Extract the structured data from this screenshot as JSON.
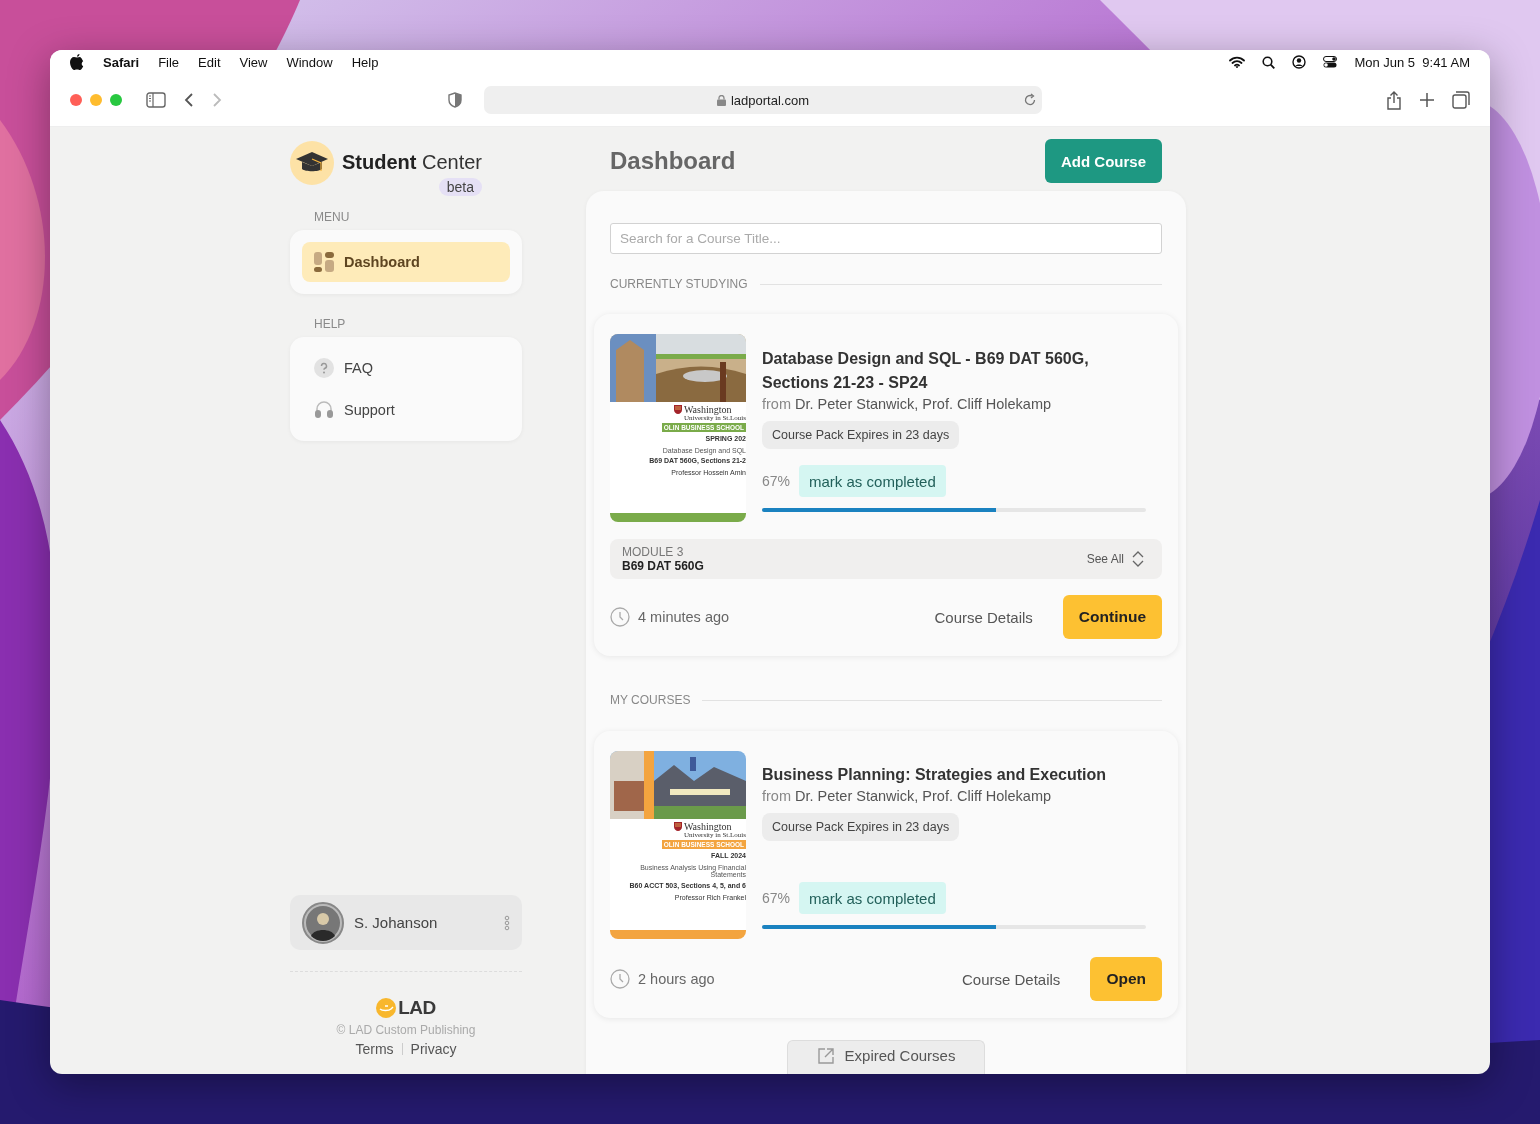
{
  "menubar": {
    "app": "Safari",
    "menus": [
      "File",
      "Edit",
      "View",
      "Window",
      "Help"
    ],
    "clock": "Mon Jun 5  9:41 AM"
  },
  "browser": {
    "url": "ladportal.com"
  },
  "brand": {
    "title_bold": "Student",
    "title_light": "Center",
    "badge": "beta"
  },
  "sidebar": {
    "sections": [
      {
        "label": "MENU",
        "items": [
          {
            "label": "Dashboard",
            "selected": true
          }
        ]
      },
      {
        "label": "HELP",
        "items": [
          {
            "label": "FAQ",
            "selected": false
          },
          {
            "label": "Support",
            "selected": false
          }
        ]
      }
    ]
  },
  "user": {
    "name": "S. Johanson"
  },
  "footer": {
    "logo": "LAD",
    "copyright": "© LAD Custom Publishing",
    "links": [
      "Terms",
      "Privacy"
    ]
  },
  "page": {
    "title": "Dashboard",
    "primary_button": "Add Course"
  },
  "search": {
    "placeholder": "Search for a Course Title..."
  },
  "sections": [
    {
      "label": "CURRENTLY STUDYING",
      "courses": [
        {
          "title": "Database Design and SQL - B69 DAT 560G, Sections 21-23 - SP24",
          "from": "from",
          "instructors": "Dr. Peter Stanwick, Prof. Cliff Holekamp",
          "expiry": "Course Pack Expires in 23 days",
          "percent": "67%",
          "complete_button": "mark as completed",
          "level": 0.61,
          "module": {
            "label": "MODULE 3",
            "code": "B69 DAT 560G",
            "see_all": "See All"
          },
          "time": "4 minutes ago",
          "details_button": "Course Details",
          "action_button": "Continue",
          "cover": {
            "color": "#7aab4a",
            "crest": [
              "Washington",
              "University in St.Louis"
            ],
            "school": "OLIN BUSINESS SCHOOL",
            "lines": [
              {
                "text": "SPRING 202",
                "kind": "bold"
              },
              {
                "text": "Database Design and SQL",
                "kind": "plain"
              },
              {
                "text": "B69 DAT 560G, Sections 21-2",
                "kind": "bold"
              },
              {
                "text": "Professor Hossein Amin",
                "kind": "small"
              }
            ]
          }
        }
      ]
    },
    {
      "label": "MY COURSES",
      "courses": [
        {
          "title": "Business Planning: Strategies and Execution",
          "from": "from",
          "instructors": "Dr. Peter Stanwick, Prof. Cliff Holekamp",
          "expiry": "Course Pack Expires in 23 days",
          "percent": "67%",
          "complete_button": "mark as completed",
          "level": 0.61,
          "time": "2 hours ago",
          "details_button": "Course Details",
          "action_button": "Open",
          "cover": {
            "color": "#f3a43f",
            "crest": [
              "Washington",
              "University in St.Louis"
            ],
            "school": "OLIN BUSINESS SCHOOL",
            "lines": [
              {
                "text": "FALL 2024",
                "kind": "bold"
              },
              {
                "text": "Business Analysis Using Financial Statements",
                "kind": "plain"
              },
              {
                "text": "B60 ACCT 503, Sections 4, 5, and 6",
                "kind": "bold"
              },
              {
                "text": "Professor Rich Frankel",
                "kind": "small"
              }
            ]
          }
        }
      ]
    }
  ],
  "expired_button": "Expired Courses"
}
